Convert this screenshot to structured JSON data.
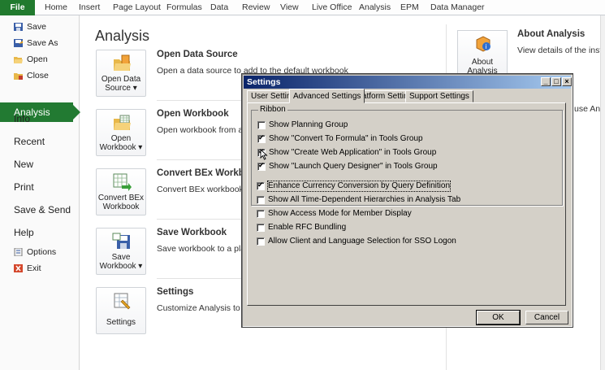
{
  "ribbon": {
    "tabs": [
      "File",
      "Home",
      "Insert",
      "Page Layout",
      "Formulas",
      "Data",
      "Review",
      "View",
      "Live Office",
      "Analysis",
      "EPM",
      "Data Manager"
    ]
  },
  "leftnav": {
    "small_top": [
      "Save",
      "Save As",
      "Open",
      "Close"
    ],
    "selected": "Analysis",
    "big": [
      "Info",
      "Recent",
      "New",
      "Print",
      "Save & Send",
      "Help"
    ],
    "small_bottom": [
      "Options",
      "Exit"
    ]
  },
  "main": {
    "title": "Analysis",
    "sections": [
      {
        "button": "Open Data Source ▾",
        "title": "Open Data Source",
        "desc": "Open a data source to add to the default workbook"
      },
      {
        "button": "Open Workbook ▾",
        "title": "Open Workbook",
        "desc": "Open workbook from a pla"
      },
      {
        "button": "Convert BEx Workbook",
        "title": "Convert BEx Workbook",
        "desc": "Convert BEx workbook to A"
      },
      {
        "button": "Save Workbook ▾",
        "title": "Save Workbook",
        "desc": "Save workbook to a platfo"
      },
      {
        "button": "Settings",
        "title": "Settings",
        "desc": "Customize Analysis to mee"
      }
    ],
    "about": {
      "button": "About Analysis",
      "title": "About Analysis",
      "desc": "View details of the installed"
    },
    "fragment_right": "use Ana"
  },
  "dialog": {
    "title": "Settings",
    "tabs": [
      "User Settings",
      "Advanced Settings",
      "Platform Settings",
      "Support Settings"
    ],
    "active_tab": "Advanced Settings",
    "group_label": "Ribbon",
    "ribbon_options": [
      {
        "label": "Show Planning Group",
        "checked": false
      },
      {
        "label": "Show \"Convert To Formula\" in Tools Group",
        "checked": true
      },
      {
        "label": "Show \"Create Web Application\" in Tools Group",
        "checked": true
      },
      {
        "label": "Show \"Launch Query Designer\" in Tools Group",
        "checked": true
      }
    ],
    "other_options": [
      {
        "label": "Enhance Currency Conversion by Query Definition",
        "checked": true
      },
      {
        "label": "Show All Time-Dependent Hierarchies in Analysis Tab",
        "checked": false
      },
      {
        "label": "Show Access Mode for Member Display",
        "checked": false
      },
      {
        "label": "Enable RFC Bundling",
        "checked": false
      },
      {
        "label": "Allow Client and Language Selection for SSO Logon",
        "checked": false
      }
    ],
    "ok_label": "OK",
    "cancel_label": "Cancel"
  },
  "colors": {
    "file_tab": "#217a2e",
    "selected_nav": "#227a32",
    "dialog_title_start": "#0a246a",
    "dialog_face": "#d4d0c8"
  }
}
